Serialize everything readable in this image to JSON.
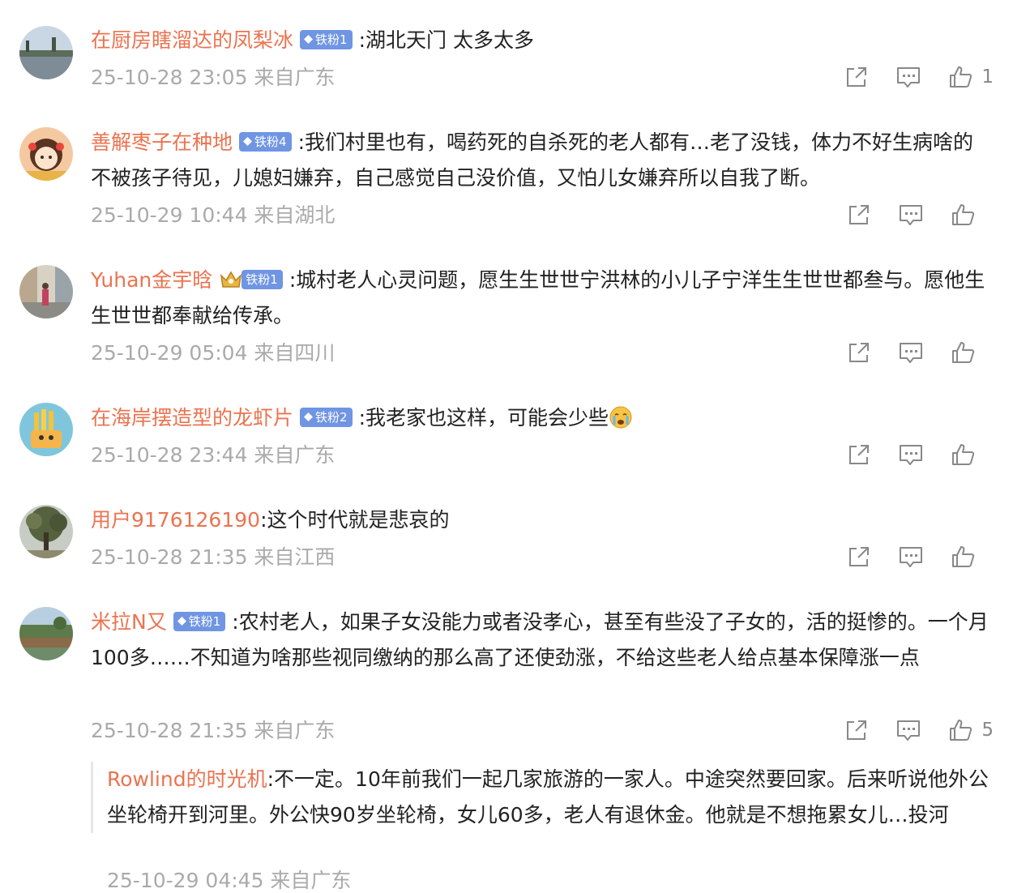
{
  "colors": {
    "username": "#eb7350",
    "meta": "#aaaaaa",
    "badge_bg": "#6f95e3",
    "text": "#222222"
  },
  "comments": [
    {
      "username": "在厨房瞎溜达的凤梨冰",
      "badge": "铁粉1",
      "sep": ":",
      "content": "湖北天门 太多太多",
      "meta": "25-10-28 23:05 来自广东",
      "like_count": "1",
      "avatar": "river-landscape-avatar"
    },
    {
      "username": "善解枣子在种地",
      "badge": "铁粉4",
      "sep": ":",
      "content": "我们村里也有，喝药死的自杀死的老人都有…老了没钱，体力不好生病啥的不被孩子待见，儿媳妇嫌弃，自己感觉自己没价值，又怕儿女嫌弃所以自我了断。",
      "meta": "25-10-29 10:44 来自湖北",
      "like_count": "",
      "avatar": "cartoon-girl-avatar"
    },
    {
      "username": "Yuhan金宇晗",
      "badge": "铁粉1",
      "sep": ":",
      "content": "城村老人心灵问题，愿生生世世宁洪林的小儿子宁洋生生世世都叁与。愿他生生世世都奉献给传承。",
      "meta": "25-10-29 05:04 来自四川",
      "like_count": "",
      "avatar": "street-photo-avatar"
    },
    {
      "username": "在海岸摆造型的龙虾片",
      "badge": "铁粉2",
      "sep": ":",
      "content": "我老家也这样，可能会少些",
      "meta": "25-10-28 23:44 来自广东",
      "like_count": "",
      "avatar": "fries-cartoon-avatar"
    },
    {
      "username": "用户9176126190",
      "badge": "",
      "sep": ":",
      "content": "这个时代就是悲哀的",
      "meta": "25-10-28 21:35 来自江西",
      "like_count": "",
      "avatar": "tree-avatar"
    },
    {
      "username": "米拉N又",
      "badge": "铁粉1",
      "sep": ":",
      "content": "农村老人，如果子女没能力或者没孝心，甚至有些没了子女的，活的挺惨的。一个月100多……不知道为啥那些视同缴纳的那么高了还使劲涨，不给这些老人给点基本保障涨一点",
      "meta": "25-10-28 21:35 来自广东",
      "like_count": "5",
      "avatar": "riverside-avatar"
    }
  ],
  "reply": {
    "username": "Rowlind的时光机",
    "sep": ":",
    "content": "不一定。10年前我们一起几家旅游的一家人。中途突然要回家。后来听说他外公坐轮椅开到河里。外公快90岁坐轮椅，女儿60多，老人有退休金。他就是不想拖累女儿…投河",
    "meta": "25-10-29 04:45 来自广东"
  }
}
